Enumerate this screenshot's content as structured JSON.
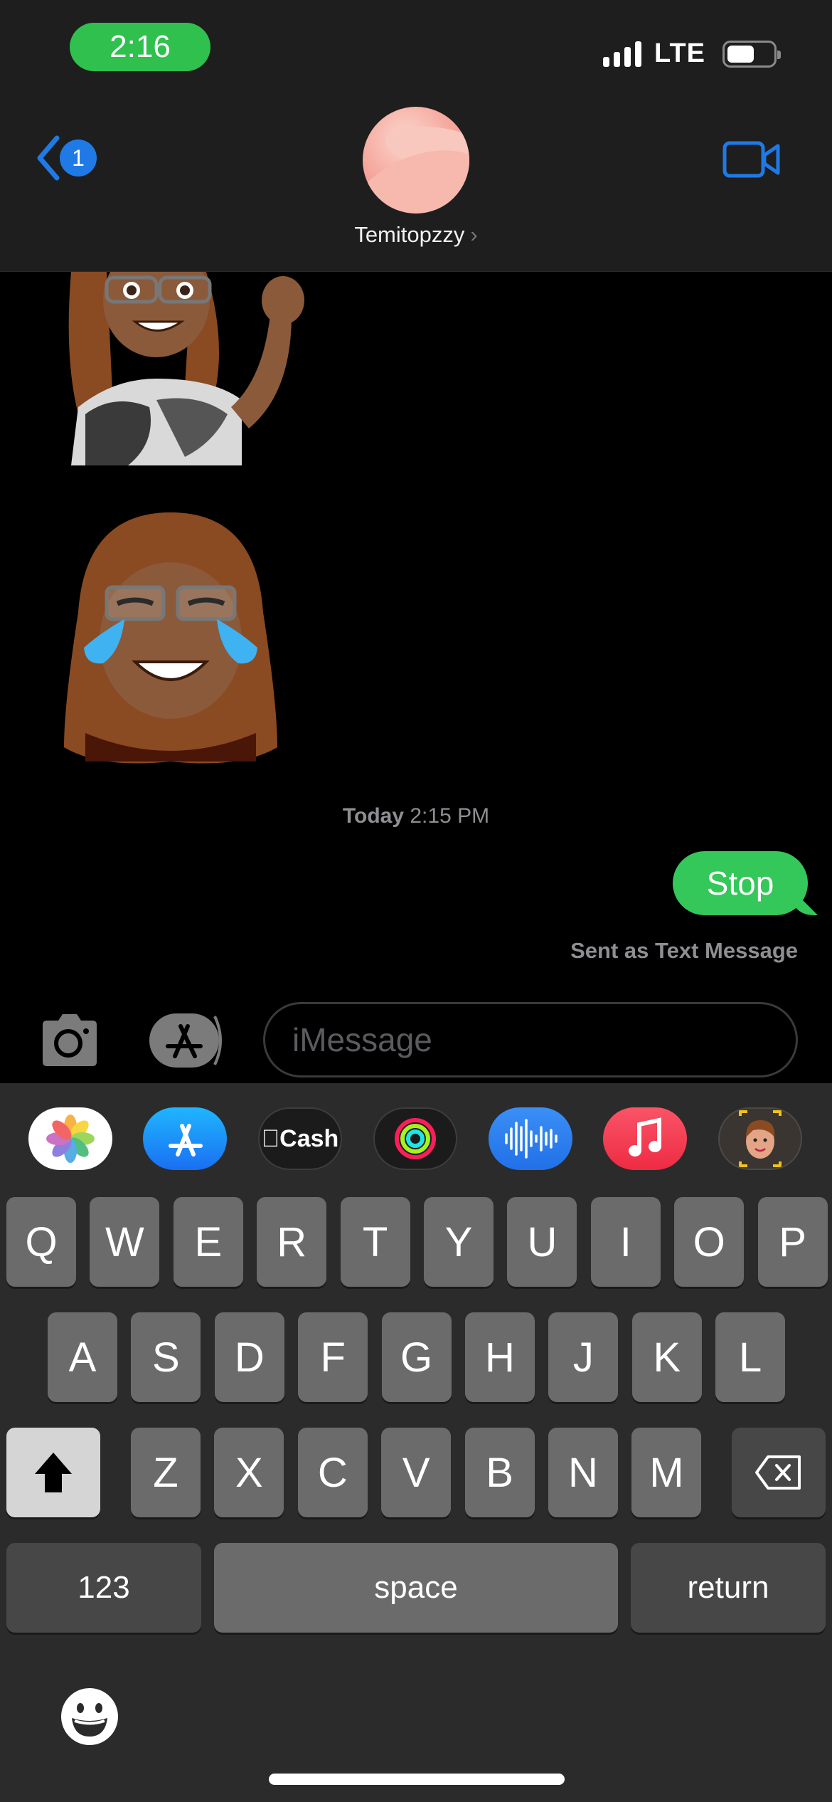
{
  "status_bar": {
    "time": "2:16",
    "network": "LTE",
    "signal_bars": 4,
    "battery_level": 0.6
  },
  "header": {
    "back_badge_count": "1",
    "contact_name": "Temitopzzy",
    "contact_chevron": "›",
    "icons": {
      "back": "chevron-left-icon",
      "video": "video-camera-icon"
    }
  },
  "conversation": {
    "stickers": [
      {
        "type": "memoji-sticker",
        "description": "waving memoji"
      },
      {
        "type": "memoji-sticker",
        "description": "tears of joy memoji"
      }
    ],
    "timestamp_day": "Today",
    "timestamp_time": "2:15 PM",
    "messages": [
      {
        "direction": "sent",
        "text": "Stop",
        "service": "sms"
      }
    ],
    "delivery_note": "Sent as Text Message"
  },
  "input_bar": {
    "placeholder": "iMessage",
    "value": "",
    "icons": {
      "camera": "camera-icon",
      "apps": "app-store-icon"
    }
  },
  "app_strip": [
    {
      "name": "Photos",
      "icon": "photos-icon"
    },
    {
      "name": "App Store",
      "icon": "app-store-icon"
    },
    {
      "name": "Apple Cash",
      "icon": "apple-cash-icon",
      "label": "Cash"
    },
    {
      "name": "Activity",
      "icon": "activity-rings-icon"
    },
    {
      "name": "Audio",
      "icon": "audio-waveform-icon"
    },
    {
      "name": "Music",
      "icon": "music-note-icon"
    },
    {
      "name": "Memoji",
      "icon": "memoji-icon"
    }
  ],
  "keyboard": {
    "row1": [
      "Q",
      "W",
      "E",
      "R",
      "T",
      "Y",
      "U",
      "I",
      "O",
      "P"
    ],
    "row2": [
      "A",
      "S",
      "D",
      "F",
      "G",
      "H",
      "J",
      "K",
      "L"
    ],
    "row3": [
      "Z",
      "X",
      "C",
      "V",
      "B",
      "N",
      "M"
    ],
    "numbers_label": "123",
    "space_label": "space",
    "return_label": "return",
    "shift_active": true,
    "icons": {
      "shift": "shift-arrow-icon",
      "delete": "backspace-icon",
      "emoji": "emoji-face-icon"
    }
  },
  "colors": {
    "sms_bubble": "#34c759",
    "accent_blue": "#1f7ae6",
    "time_pill": "#30c04e"
  }
}
